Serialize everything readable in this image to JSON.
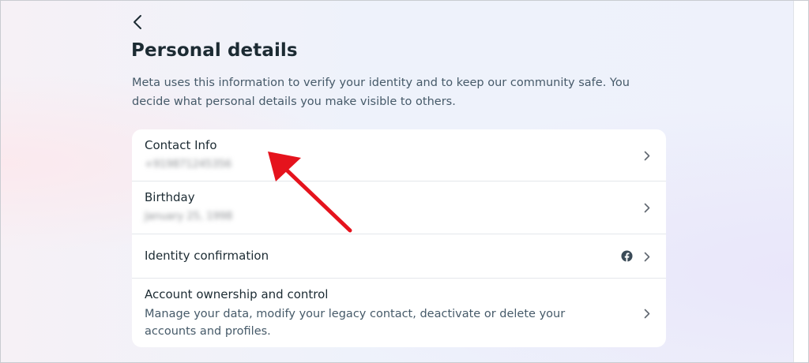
{
  "header": {
    "back_label": "",
    "title": "Personal details",
    "description": "Meta uses this information to verify your identity and to keep our community safe. You decide what personal details you make visible to others."
  },
  "rows": [
    {
      "label": "Contact Info",
      "sub": "+919871245356"
    },
    {
      "label": "Birthday",
      "sub": "January 25, 1998"
    },
    {
      "label": "Identity confirmation"
    },
    {
      "label": "Account ownership and control",
      "desc": "Manage your data, modify your legacy contact, deactivate or delete your accounts and profiles."
    }
  ],
  "icons": {
    "back": "chevron-left-icon",
    "chevron": "chevron-right-icon",
    "identity_badge": "facebook-icon",
    "annotation": "red-arrow-annotation"
  },
  "colors": {
    "title": "#1c2b33",
    "text_secondary": "#465a69",
    "card": "#ffffff",
    "annotation": "#e5131d"
  }
}
